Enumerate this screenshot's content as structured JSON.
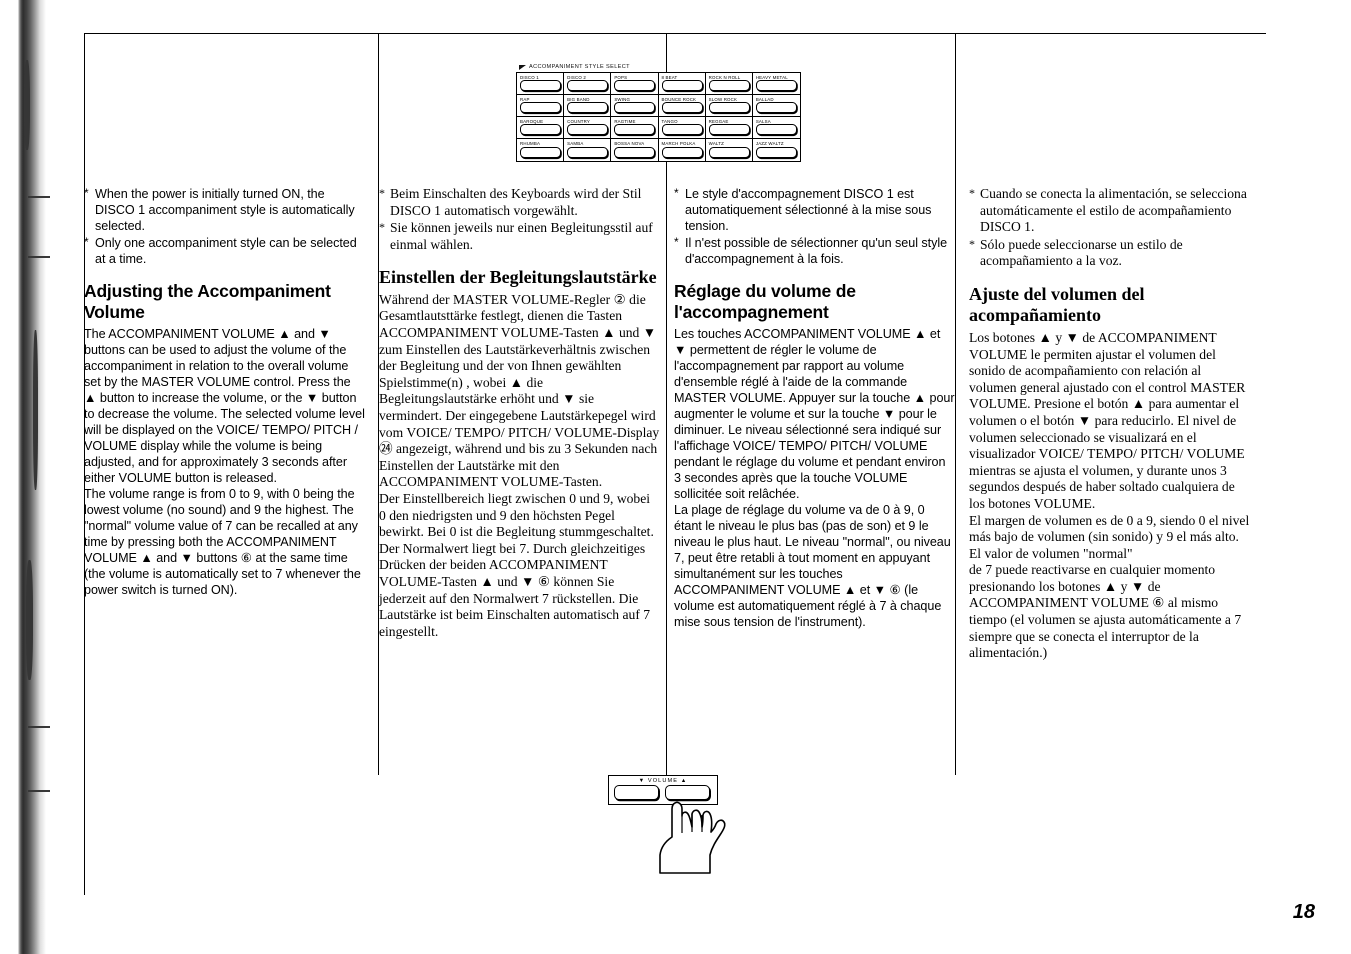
{
  "page": {
    "number": "18"
  },
  "illustration_style_select": {
    "caption": "ACCOMPANIMENT STYLE SELECT",
    "buttons": [
      "DISCO 1",
      "DISCO 2",
      "POPS",
      "8 BEAT",
      "ROCK N ROLL",
      "HEAVY METAL",
      "RAP",
      "BIG BAND",
      "SWING",
      "BOUNCE ROCK",
      "SLOW ROCK",
      "BALLAD",
      "BAROQUE",
      "COUNTRY",
      "RAGTIME",
      "TANGO",
      "REGGAE",
      "SALSA",
      "RHUMBA",
      "SAMBA",
      "BOSSA NOVA",
      "MARCH POLKA",
      "WALTZ",
      "JAZZ WALTZ"
    ]
  },
  "illustration_volume": {
    "label": "VOLUME",
    "down_symbol": "▼",
    "up_symbol": "▲"
  },
  "columns": {
    "english": {
      "notes": [
        "When the power is initially turned ON, the DISCO 1 accompaniment style is automatically selected.",
        "Only one accompaniment style can be selected at a time."
      ],
      "heading": "Adjusting the Accompaniment Volume",
      "body": "The ACCOMPANIMENT VOLUME ▲ and ▼ buttons can be used to adjust the volume of the accompaniment in relation to the overall volume set by the MASTER VOLUME control. Press the ▲ button to increase the volume, or the ▼ button to decrease the volume. The selected volume level will be displayed on the VOICE/ TEMPO/ PITCH / VOLUME display while the volume is being adjusted, and for approximately 3 seconds after either VOLUME button is released.\nThe volume range is from 0 to 9, with 0 being the lowest volume (no sound) and 9 the highest. The \"normal\" volume value of 7 can be recalled at any time by pressing both the ACCOMPANIMENT VOLUME ▲ and ▼ buttons ⑥ at the same time (the volume is automatically set to 7 whenever the power switch is turned ON)."
    },
    "german": {
      "notes": [
        "Beim Einschalten des Keyboards wird der Stil DISCO 1 automatisch vorgewählt.",
        "Sie können jeweils nur einen Begleitungsstil auf einmal wählen."
      ],
      "heading": "Einstellen der Begleitungslautstärke",
      "body": "Während der MASTER VOLUME-Regler ② die Gesamtlautsttärke festlegt, dienen die Tasten ACCOMPANIMENT VOLUME-Tasten ▲ und ▼ zum Einstellen des Lautstärkeverhältnis zwischen der Begleitung und der von Ihnen gewählten Spielstimme(n) , wobei ▲ die Begleitungslautstärke erhöht und ▼ sie vermindert. Der eingegebene Lautstärkepegel wird vom VOICE/ TEMPO/ PITCH/ VOLUME-Display ㉔ angezeigt, während und bis zu 3 Sekunden nach Einstellen der Lautstärke mit den ACCOMPANIMENT VOLUME-Tasten.\nDer Einstellbereich liegt zwischen 0 und 9, wobei 0 den niedrigsten und 9 den höchsten Pegel bewirkt. Bei 0 ist die Begleitung stummgeschaltet. Der Normalwert liegt bei 7. Durch gleichzeitiges Drücken der beiden ACCOMPANIMENT VOLUME-Tasten ▲ und ▼ ⑥ können Sie jederzeit auf den Normalwert 7 rückstellen. Die Lautstärke ist beim Einschalten automatisch auf 7 eingestellt."
    },
    "french": {
      "notes": [
        "Le style d'accompagnement DISCO 1 est automatiquement sélectionné à la mise sous tension.",
        "Il n'est possible de sélectionner qu'un seul style d'accompagnement à la fois."
      ],
      "heading": "Réglage du volume de l'accompagnement",
      "body": "Les touches ACCOMPANIMENT VOLUME ▲ et ▼ permettent de régler le volume de l'accompagnement par rapport au volume d'ensemble réglé à l'aide de la commande MASTER VOLUME. Appuyer sur la touche ▲ pour augmenter le volume et sur la touche ▼ pour le diminuer. Le niveau sélectionné sera indiqué sur l'affichage VOICE/ TEMPO/ PITCH/ VOLUME pendant le réglage du volume et pendant environ 3 secondes après que la touche VOLUME sollicitée soit relâchée.\nLa plage de réglage du volume va de 0 à 9, 0 étant le niveau le plus bas (pas de son) et 9 le niveau le plus haut. Le niveau \"normal\", ou niveau 7, peut être retabli à tout moment en appuyant simultanément sur les touches ACCOMPANIMENT VOLUME ▲ et ▼ ⑥ (le volume est automatiquement réglé à 7 à chaque mise sous tension de l'instrument)."
    },
    "spanish": {
      "notes": [
        "Cuando se conecta la alimentación, se selecciona automáticamente el estilo de acompañamiento DISCO 1.",
        "Sólo puede seleccionarse un estilo de acompañamiento a la voz."
      ],
      "heading": "Ajuste del volumen del acompañamiento",
      "body": "Los botones ▲ y ▼ de ACCOMPANIMENT VOLUME le permiten ajustar el volumen del sonido de acompañamiento con relación al volumen general ajustado con el control MASTER VOLUME. Presione el botón ▲ para aumentar el volumen o el botón ▼ para reducirlo. El nivel de volumen seleccionado se visualizará en el visualizador VOICE/ TEMPO/ PITCH/ VOLUME mientras se ajusta el volumen, y durante unos 3 segundos después de haber soltado cualquiera de los botones VOLUME.\nEl margen de volumen es de 0 a 9, siendo 0 el nivel más bajo de volumen (sin sonido) y 9 el más alto. El valor de volumen \"normal\"\nde 7 puede reactivarse en cualquier momento presionando los botones ▲ y ▼ de ACCOMPANIMENT VOLUME ⑥ al mismo tiempo (el volumen se ajusta automáticamente a 7 siempre que se conecta el interruptor de la alimentación.)"
    }
  }
}
